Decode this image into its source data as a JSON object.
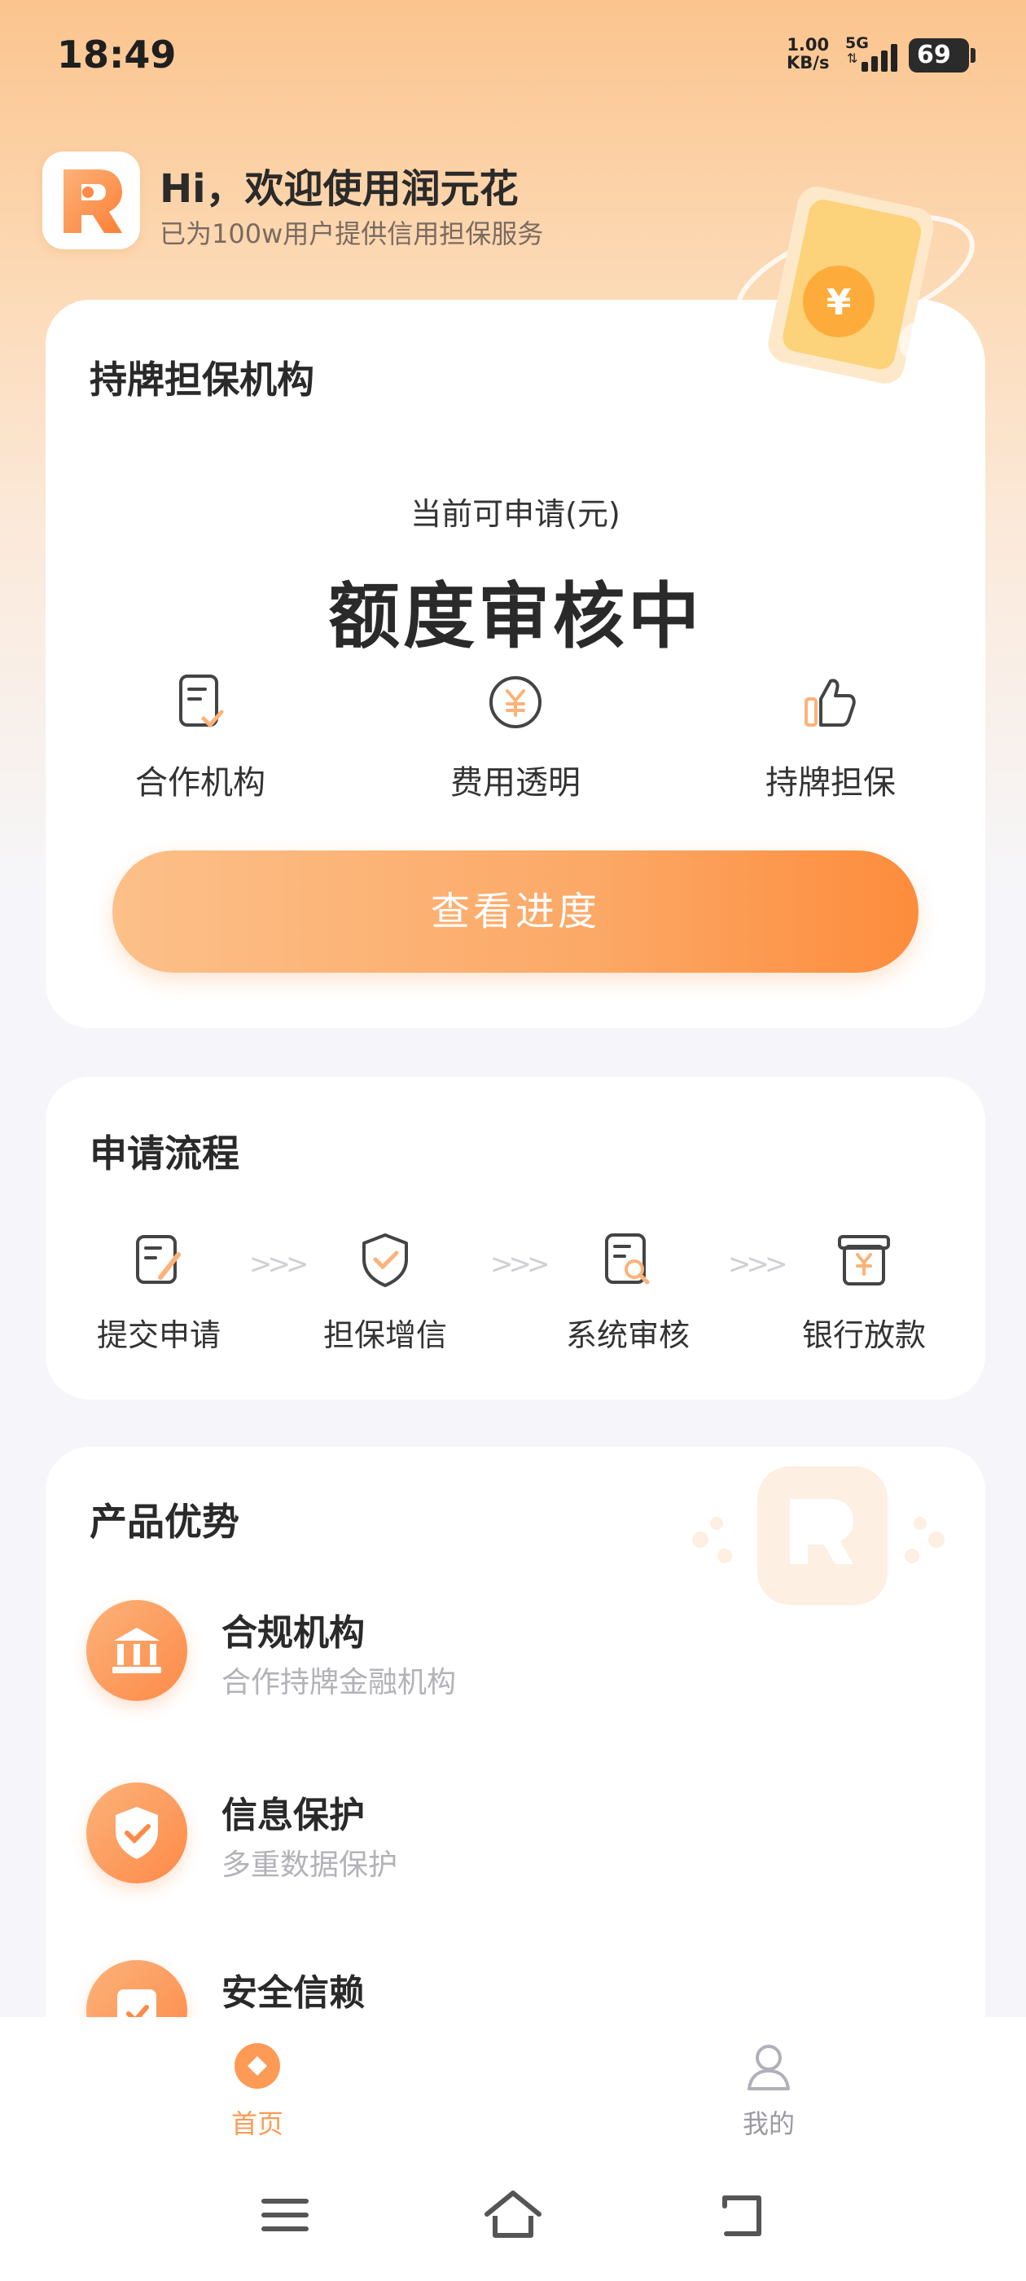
{
  "status_bar": {
    "time": "18:49",
    "net_speed_value": "1.00",
    "net_speed_unit": "KB/s",
    "signal_label": "5G",
    "battery": "69"
  },
  "header": {
    "greeting": "Hi，欢迎使用润元花",
    "subtitle": "已为100w用户提供信用担保服务"
  },
  "quota_card": {
    "title": "持牌担保机构",
    "apply_label": "当前可申请(元)",
    "apply_value": "额度审核中",
    "features": [
      {
        "label": "合作机构",
        "icon": "document-check-icon"
      },
      {
        "label": "费用透明",
        "icon": "yuan-coin-icon"
      },
      {
        "label": "持牌担保",
        "icon": "thumbs-up-icon"
      }
    ],
    "cta": "查看进度"
  },
  "process_card": {
    "title": "申请流程",
    "steps": [
      {
        "label": "提交申请",
        "icon": "edit-document-icon"
      },
      {
        "label": "担保增信",
        "icon": "shield-check-icon"
      },
      {
        "label": "系统审核",
        "icon": "document-search-icon"
      },
      {
        "label": "银行放款",
        "icon": "yuan-box-icon"
      }
    ],
    "arrow": ">>>"
  },
  "advantages_card": {
    "title": "产品优势",
    "items": [
      {
        "title": "合规机构",
        "subtitle": "合作持牌金融机构",
        "icon": "bank-icon"
      },
      {
        "title": "信息保护",
        "subtitle": "多重数据保护",
        "icon": "shield-icon"
      },
      {
        "title": "安全信赖",
        "subtitle": "",
        "icon": "safe-icon"
      }
    ]
  },
  "tab_bar": {
    "tabs": [
      {
        "label": "首页",
        "icon": "home-coin-icon",
        "active": true
      },
      {
        "label": "我的",
        "icon": "user-icon",
        "active": false
      }
    ]
  },
  "colors": {
    "accent": "#fd9a55",
    "accent_light": "#fcc089",
    "tab_active": "#fd9a55",
    "tab_inactive": "#9a9aa2"
  }
}
